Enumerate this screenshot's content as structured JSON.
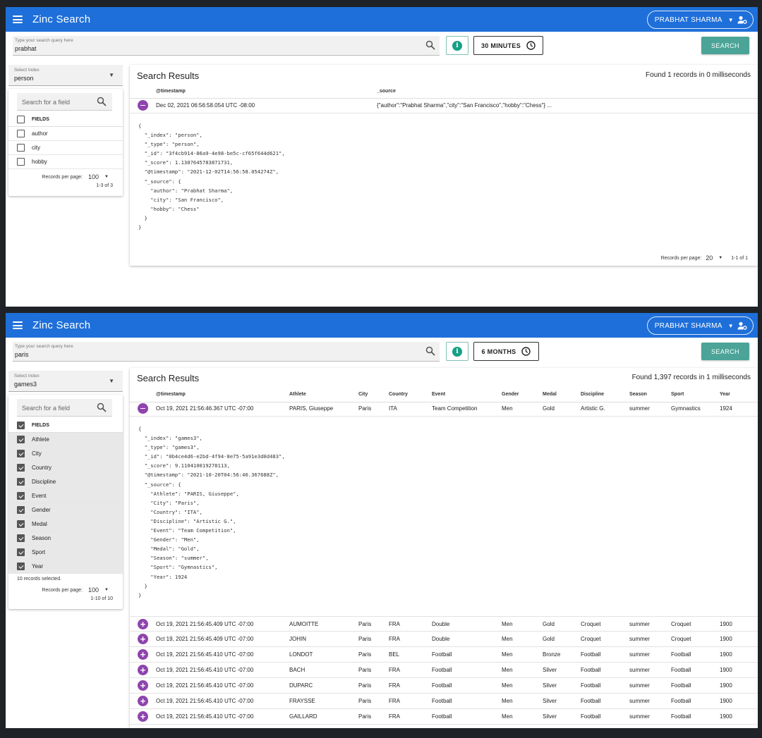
{
  "panel1": {
    "app_title": "Zinc Search",
    "user_name": "PRABHAT SHARMA",
    "query_label": "Type your search query here",
    "query_value": "prabhat",
    "time_range": "30 MINUTES",
    "search_label": "SEARCH",
    "index_label": "Select Index",
    "index_value": "person",
    "field_search_placeholder": "Search for a field",
    "fields_header": "FIELDS",
    "fields": [
      "author",
      "city",
      "hobby"
    ],
    "rpp_label": "Records per page:",
    "rpp_value": "100",
    "fields_range": "1-3 of 3",
    "results_title": "Search Results",
    "found_text": "Found 1 records in 0 milliseconds",
    "columns": [
      "@timestamp",
      "_source"
    ],
    "row": {
      "timestamp": "Dec 02, 2021 06:56:58.054 UTC -08:00",
      "source": "{\"author\":\"Prabhat Sharma\",\"city\":\"San Francisco\",\"hobby\":\"Chess\"} ..."
    },
    "json_lines": [
      "{",
      "  \"_index\": \"person\",",
      "  \"_type\": \"person\",",
      "  \"_id\": \"3f4cb914-86a9-4e98-be5c-cf65f644d621\",",
      "  \"_score\": 1.1307645783871731,",
      "  \"@timestamp\": \"2021-12-02T14:56:58.054274Z\",",
      "  \"_source\": {",
      "    \"author\": \"Prabhat Sharma\",",
      "    \"city\": \"San Francisco\",",
      "    \"hobby\": \"Chess\"",
      "  }",
      "}"
    ],
    "bottom_rpp_label": "Records per page:",
    "bottom_rpp_value": "20",
    "bottom_range": "1-1 of 1"
  },
  "panel2": {
    "app_title": "Zinc Search",
    "user_name": "PRABHAT SHARMA",
    "query_label": "Type your search query here",
    "query_value": "paris",
    "time_range": "6 MONTHS",
    "search_label": "SEARCH",
    "index_label": "Select Index",
    "index_value": "games3",
    "field_search_placeholder": "Search for a field",
    "fields_header": "FIELDS",
    "fields": [
      "Athlete",
      "City",
      "Country",
      "Discipline",
      "Event",
      "Gender",
      "Medal",
      "Season",
      "Sport",
      "Year"
    ],
    "selected_note": "10 records selected.",
    "rpp_label": "Records per page:",
    "rpp_value": "100",
    "fields_range": "1-10 of 10",
    "results_title": "Search Results",
    "found_text": "Found 1,397 records in 1 milliseconds",
    "columns": [
      "@timestamp",
      "Athlete",
      "City",
      "Country",
      "Event",
      "Gender",
      "Medal",
      "Discipline",
      "Season",
      "Sport",
      "Year"
    ],
    "expanded_row": [
      "Oct 19, 2021 21:56:46.367 UTC -07:00",
      "PARIS, Giuseppe",
      "Paris",
      "ITA",
      "Team Competition",
      "Men",
      "Gold",
      "Artistic G.",
      "summer",
      "Gymnastics",
      "1924"
    ],
    "json_lines": [
      "{",
      "  \"_index\": \"games3\",",
      "  \"_type\": \"games3\",",
      "  \"_id\": \"0b4ce4d6-e2bd-4f94-8e75-5a91e3d0d483\",",
      "  \"_score\": 9.110410019278113,",
      "  \"@timestamp\": \"2021-10-20T04:56:46.367688Z\",",
      "  \"_source\": {",
      "    \"Athlete\": \"PARIS, Giuseppe\",",
      "    \"City\": \"Paris\",",
      "    \"Country\": \"ITA\",",
      "    \"Discipline\": \"Artistic G.\",",
      "    \"Event\": \"Team Competition\",",
      "    \"Gender\": \"Men\",",
      "    \"Medal\": \"Gold\",",
      "    \"Season\": \"summer\",",
      "    \"Sport\": \"Gymnastics\",",
      "    \"Year\": 1924",
      "  }",
      "}"
    ],
    "rows": [
      [
        "Oct 19, 2021 21:56:45.409 UTC -07:00",
        "AUMOITTE",
        "Paris",
        "FRA",
        "Double",
        "Men",
        "Gold",
        "Croquet",
        "summer",
        "Croquet",
        "1900"
      ],
      [
        "Oct 19, 2021 21:56:45.409 UTC -07:00",
        "JOHIN",
        "Paris",
        "FRA",
        "Double",
        "Men",
        "Gold",
        "Croquet",
        "summer",
        "Croquet",
        "1900"
      ],
      [
        "Oct 19, 2021 21:56:45.410 UTC -07:00",
        "LONDOT",
        "Paris",
        "BEL",
        "Football",
        "Men",
        "Bronze",
        "Football",
        "summer",
        "Football",
        "1900"
      ],
      [
        "Oct 19, 2021 21:56:45.410 UTC -07:00",
        "BACH",
        "Paris",
        "FRA",
        "Football",
        "Men",
        "Silver",
        "Football",
        "summer",
        "Football",
        "1900"
      ],
      [
        "Oct 19, 2021 21:56:45.410 UTC -07:00",
        "DUPARC",
        "Paris",
        "FRA",
        "Football",
        "Men",
        "Silver",
        "Football",
        "summer",
        "Football",
        "1900"
      ],
      [
        "Oct 19, 2021 21:56:45.410 UTC -07:00",
        "FRAYSSE",
        "Paris",
        "FRA",
        "Football",
        "Men",
        "Silver",
        "Football",
        "summer",
        "Football",
        "1900"
      ],
      [
        "Oct 19, 2021 21:56:45.410 UTC -07:00",
        "GAILLARD",
        "Paris",
        "FRA",
        "Football",
        "Men",
        "Silver",
        "Football",
        "summer",
        "Football",
        "1900"
      ]
    ]
  },
  "icons": {
    "menu": "menu-icon",
    "search": "search-icon",
    "info": "info-icon",
    "clock": "clock-icon",
    "user": "user-settings-icon",
    "collapse": "collapse-row-icon",
    "expand": "expand-row-icon"
  },
  "colors": {
    "header": "#1e6fd9",
    "search_button": "#4ba497",
    "info": "#16a085",
    "row_toggle": "#8e44ad"
  }
}
